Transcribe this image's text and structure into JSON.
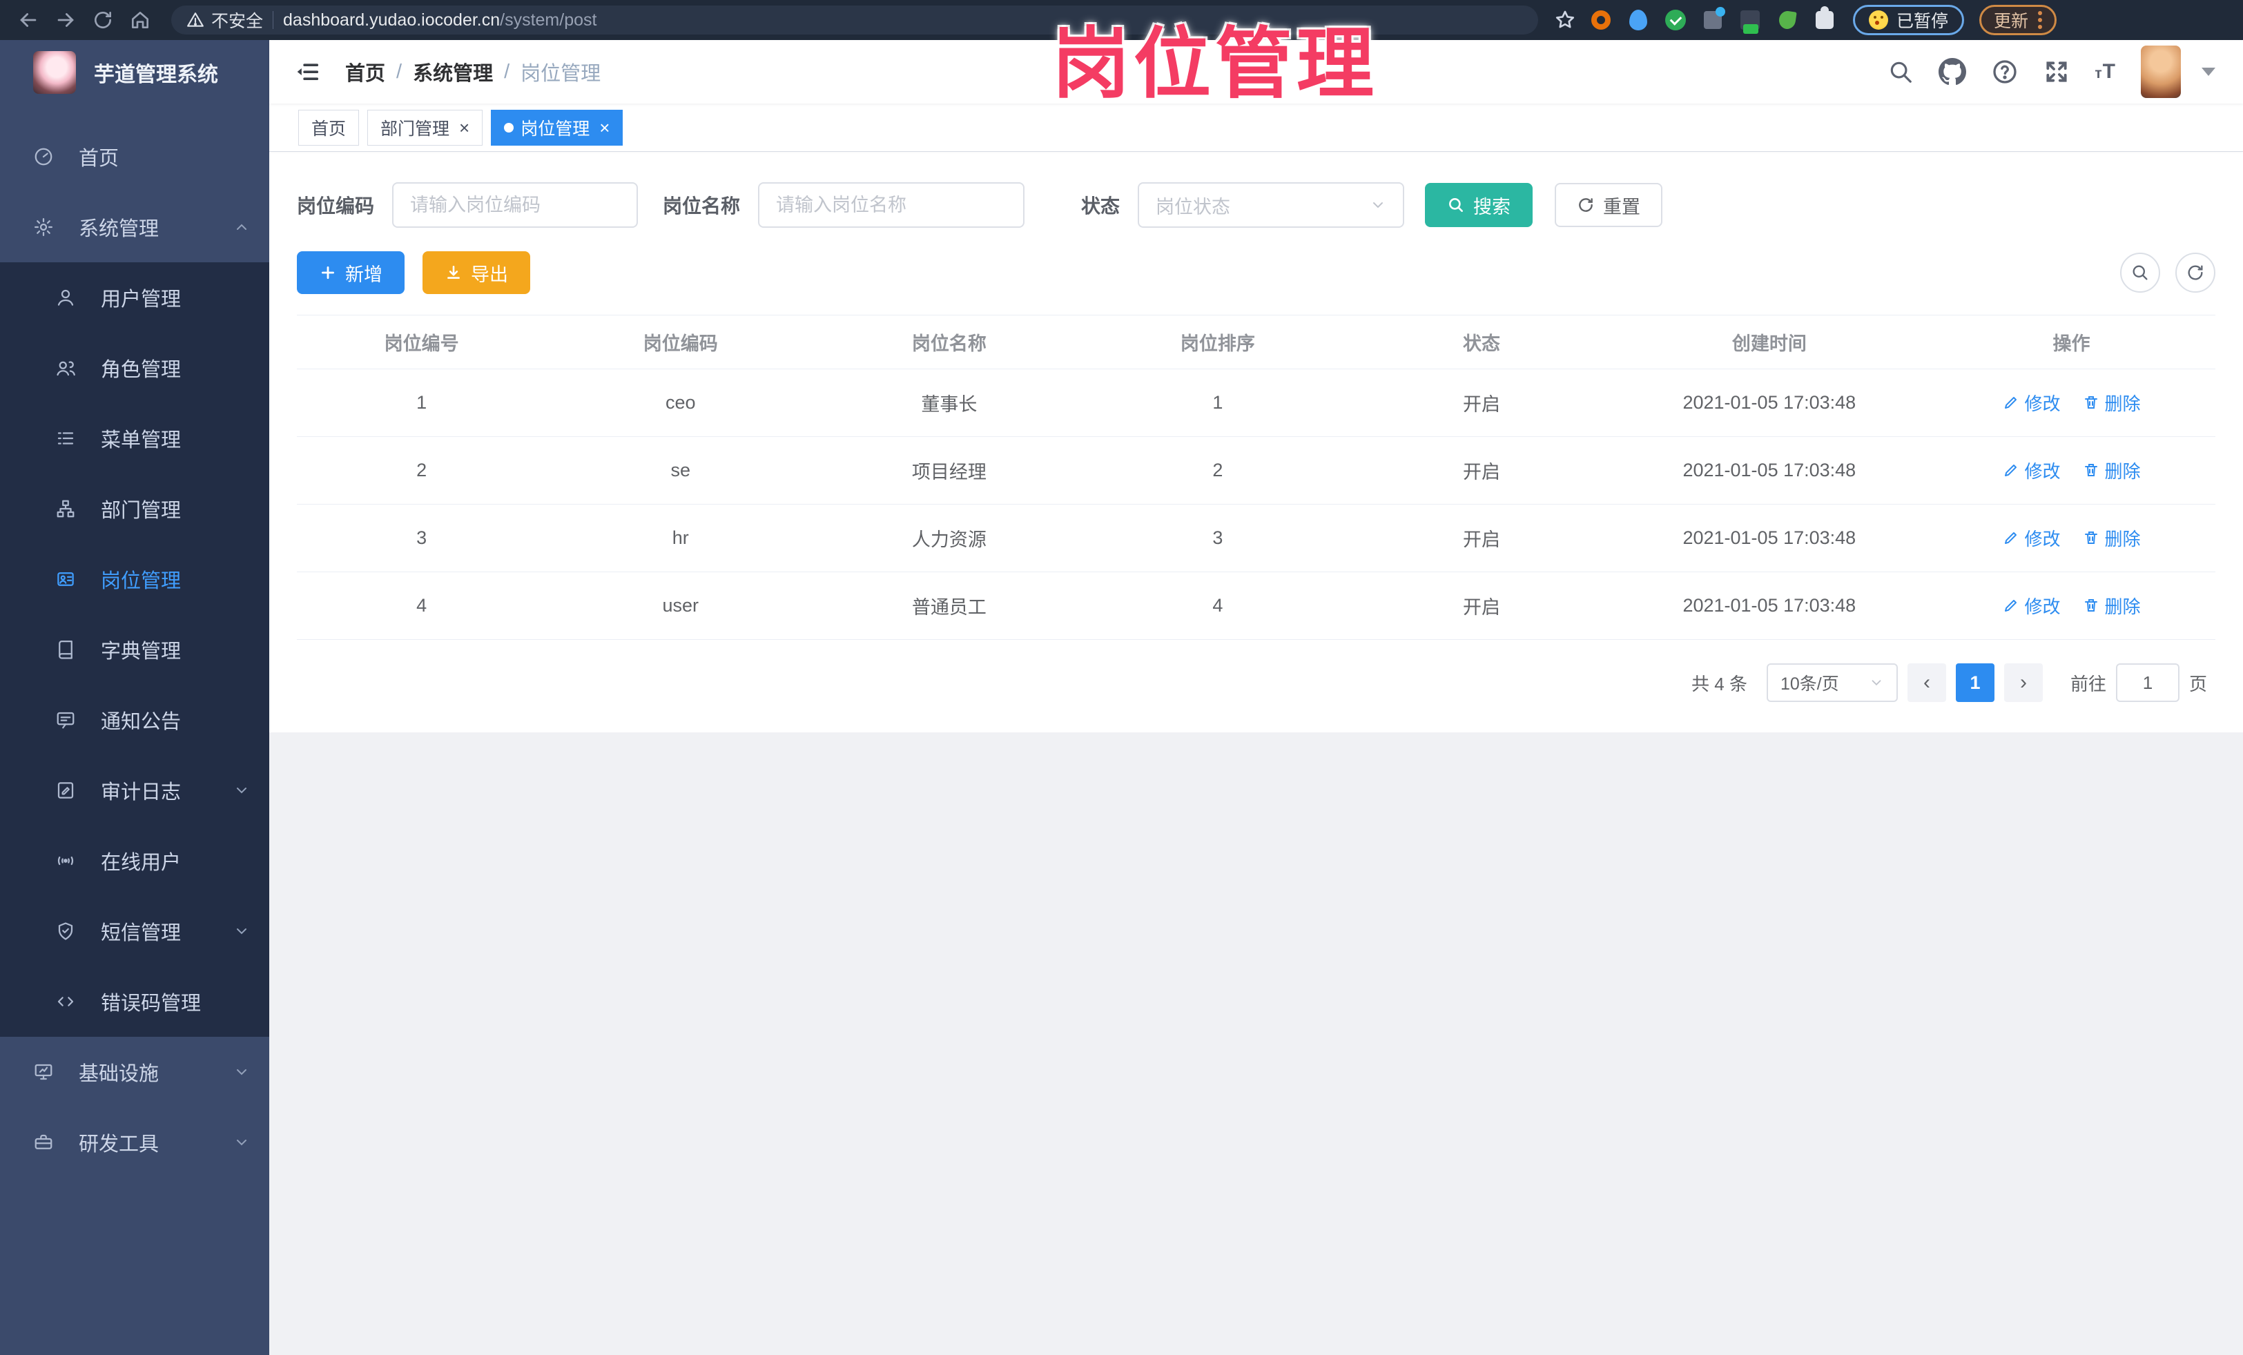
{
  "browser": {
    "security_label": "不安全",
    "url_host": "dashboard.yudao.iocoder.cn",
    "url_path": "/system/post",
    "paused_badge": "已暂停",
    "update_button": "更新"
  },
  "annotation": {
    "title": "岗位管理"
  },
  "sidebar": {
    "app_title": "芋道管理系统",
    "items": [
      {
        "label": "首页",
        "icon": "dashboard-icon"
      },
      {
        "label": "系统管理",
        "icon": "gear-icon",
        "expanded": true
      },
      {
        "label": "用户管理",
        "icon": "user-icon"
      },
      {
        "label": "角色管理",
        "icon": "role-icon"
      },
      {
        "label": "菜单管理",
        "icon": "menu-list-icon"
      },
      {
        "label": "部门管理",
        "icon": "dept-tree-icon"
      },
      {
        "label": "岗位管理",
        "icon": "post-icon",
        "active": true
      },
      {
        "label": "字典管理",
        "icon": "dict-icon"
      },
      {
        "label": "通知公告",
        "icon": "notice-icon"
      },
      {
        "label": "审计日志",
        "icon": "audit-log-icon",
        "collapsed": true
      },
      {
        "label": "在线用户",
        "icon": "online-user-icon"
      },
      {
        "label": "短信管理",
        "icon": "sms-shield-icon",
        "collapsed": true
      },
      {
        "label": "错误码管理",
        "icon": "error-code-icon"
      },
      {
        "label": "基础设施",
        "icon": "infra-monitor-icon",
        "collapsed": true
      },
      {
        "label": "研发工具",
        "icon": "devtools-icon",
        "collapsed": true
      }
    ]
  },
  "header": {
    "breadcrumb": [
      "首页",
      "系统管理",
      "岗位管理"
    ]
  },
  "tabs": [
    {
      "label": "首页",
      "closable": false,
      "active": false
    },
    {
      "label": "部门管理",
      "closable": true,
      "active": false
    },
    {
      "label": "岗位管理",
      "closable": true,
      "active": true
    }
  ],
  "ui": {
    "close_glyph": "×",
    "breadcrumb_sep": "/",
    "prev_glyph": "‹",
    "next_glyph": "›"
  },
  "filters": {
    "post_code": {
      "label": "岗位编码",
      "placeholder": "请输入岗位编码"
    },
    "post_name": {
      "label": "岗位名称",
      "placeholder": "请输入岗位名称"
    },
    "status": {
      "label": "状态",
      "placeholder": "岗位状态"
    },
    "search_label": "搜索",
    "reset_label": "重置"
  },
  "toolbar": {
    "add_label": "新增",
    "export_label": "导出"
  },
  "table": {
    "columns": [
      "岗位编号",
      "岗位编码",
      "岗位名称",
      "岗位排序",
      "状态",
      "创建时间",
      "操作"
    ],
    "edit_label": "修改",
    "delete_label": "删除",
    "rows": [
      {
        "id": "1",
        "code": "ceo",
        "name": "董事长",
        "sort": "1",
        "status": "开启",
        "created": "2021-01-05 17:03:48"
      },
      {
        "id": "2",
        "code": "se",
        "name": "项目经理",
        "sort": "2",
        "status": "开启",
        "created": "2021-01-05 17:03:48"
      },
      {
        "id": "3",
        "code": "hr",
        "name": "人力资源",
        "sort": "3",
        "status": "开启",
        "created": "2021-01-05 17:03:48"
      },
      {
        "id": "4",
        "code": "user",
        "name": "普通员工",
        "sort": "4",
        "status": "开启",
        "created": "2021-01-05 17:03:48"
      }
    ]
  },
  "pagination": {
    "total": "共 4 条",
    "page_size": "10条/页",
    "current": "1",
    "goto_label": "前往",
    "goto_value": "1",
    "unit_label": "页"
  },
  "colors": {
    "primary_blue": "#2d8cf0",
    "sidebar_bg": "#3b4a6b",
    "submenu_bg": "#222d45",
    "active_menu": "#409eff",
    "search_teal": "#2bb7a2",
    "export_amber": "#f4a71d",
    "annotation_pink": "#f43c63",
    "chrome_bg": "#202a39"
  }
}
